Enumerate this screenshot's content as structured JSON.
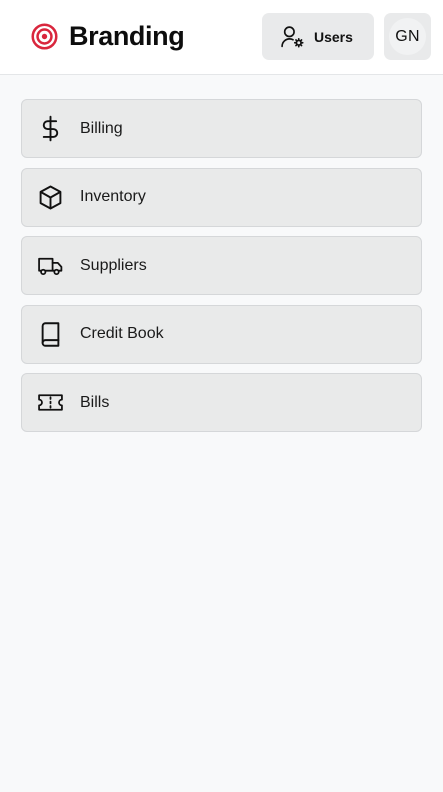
{
  "header": {
    "brand": {
      "title": "Branding",
      "logo_icon": "target-icon",
      "logo_color": "#d9263d"
    },
    "users_button": {
      "label": "Users",
      "icon": "user-gear-icon"
    },
    "avatar": {
      "initials": "GN"
    }
  },
  "menu": {
    "items": [
      {
        "label": "Billing",
        "icon": "dollar-icon"
      },
      {
        "label": "Inventory",
        "icon": "box-icon"
      },
      {
        "label": "Suppliers",
        "icon": "truck-icon"
      },
      {
        "label": "Credit Book",
        "icon": "book-icon"
      },
      {
        "label": "Bills",
        "icon": "ticket-icon"
      }
    ]
  },
  "colors": {
    "background": "#f8f9fa",
    "header_background": "#ffffff",
    "card_background": "#e9eaea",
    "card_border": "#d5d7d9",
    "accent": "#d9263d"
  }
}
